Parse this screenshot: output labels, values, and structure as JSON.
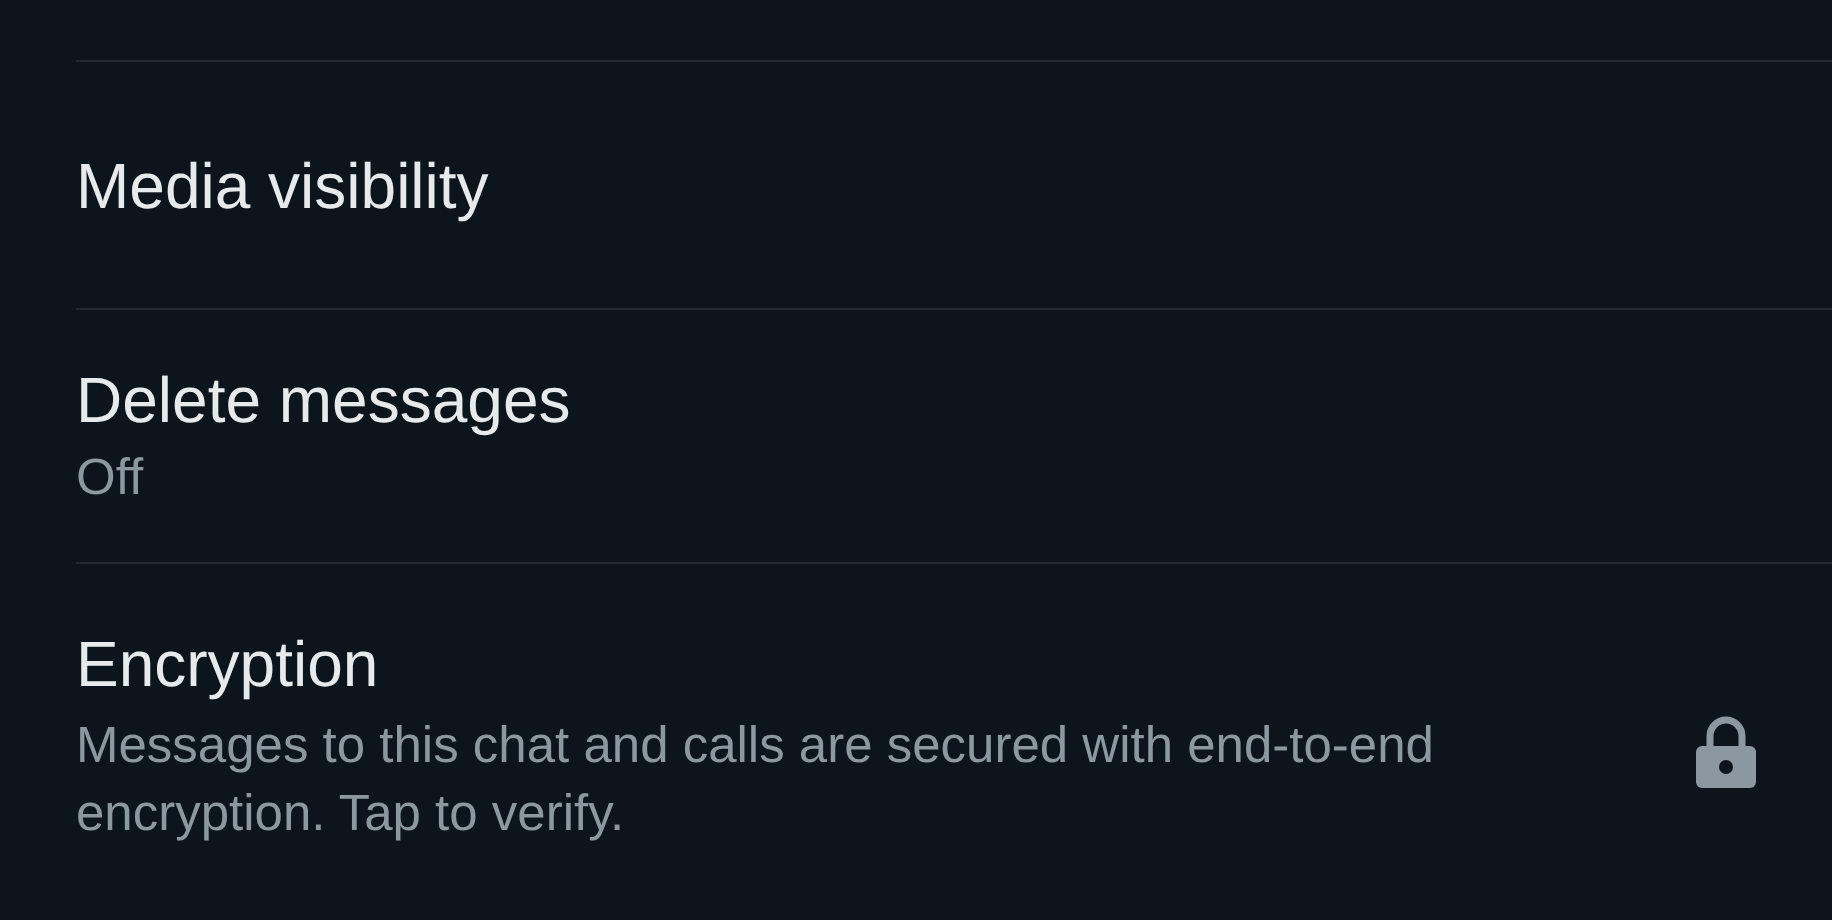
{
  "settings": [
    {
      "kind": "plain",
      "title": "Media visibility"
    },
    {
      "kind": "subtitle",
      "title": "Delete messages",
      "subtitle": "Off"
    },
    {
      "kind": "lock",
      "title": "Encryption",
      "subtitle": "Messages to this chat and calls are secured with end-to-end encryption. Tap to verify."
    }
  ]
}
